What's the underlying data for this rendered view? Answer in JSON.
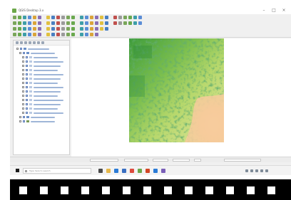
{
  "window": {
    "title": "QGIS Desktop 3.x",
    "controls": {
      "minimize": "–",
      "maximize": "□",
      "close": "×"
    }
  },
  "colors": {
    "accent": "#6ca84a",
    "raster_low": "#f6c99b",
    "raster_mid": "#c8df7a",
    "raster_high": "#1f8a3a"
  },
  "toolbars": {
    "row1_icons": [
      "new-project-icon",
      "open-project-icon",
      "save-project-icon",
      "save-as-icon",
      "print-layout-icon",
      "layout-manager-icon",
      "pan-icon",
      "pan-to-selection-icon",
      "zoom-in-icon",
      "zoom-out-icon",
      "zoom-full-icon",
      "zoom-layer-icon",
      "zoom-native-icon",
      "refresh-icon",
      "identify-icon",
      "select-icon",
      "deselect-icon",
      "measure-icon",
      "attribute-table-icon",
      "field-calculator-icon",
      "statistics-icon",
      "bookmark-icon",
      "tips-icon",
      "plugins-icon"
    ],
    "row2_icons": [
      "add-vector-icon",
      "add-raster-icon",
      "add-mesh-icon",
      "add-csv-icon",
      "add-geopackage-icon",
      "add-spatialite-icon",
      "add-postgis-icon",
      "add-wms-icon",
      "add-wfs-icon",
      "new-shapefile-icon",
      "new-geopackage-icon",
      "digitize-icon",
      "edit-toggle-icon",
      "add-feature-icon",
      "vertex-tool-icon",
      "delete-icon",
      "cut-icon",
      "copy-icon",
      "paste-icon",
      "undo-icon",
      "redo-icon",
      "label-icon",
      "label-pin-icon",
      "diagram-icon"
    ],
    "row3_icons": [
      "processing-icon",
      "python-console-icon",
      "gps-icon",
      "georeferencer-icon",
      "raster-calculator-icon",
      "style-manager-icon",
      "annotation-icon",
      "text-annotation-icon",
      "html-annotation-icon",
      "svg-annotation-icon",
      "form-annotation-icon",
      "measure-angle-icon",
      "measure-area-icon",
      "map-tips-icon",
      "new-bookmark-icon",
      "show-bookmarks-icon",
      "temporal-icon",
      "3d-view-icon"
    ],
    "row4_icons": [
      "snapping-icon",
      "tracing-icon",
      "digitize-settings-icon",
      "avoid-overlap-icon",
      "topology-icon",
      "shape-circle-icon",
      "shape-rect-icon",
      "shape-polygon-icon",
      "offset-curve-icon",
      "reshape-icon",
      "split-icon",
      "merge-icon",
      "rotate-icon",
      "simplify-icon",
      "fill-ring-icon",
      "delete-ring-icon"
    ]
  },
  "layers_panel": {
    "toolbar_icons": [
      "open-layer-styling-icon",
      "add-group-icon",
      "manage-map-themes-icon",
      "filter-legend-icon",
      "expand-all-icon",
      "collapse-all-icon",
      "remove-layer-icon"
    ],
    "rows": [
      {
        "indent": 1,
        "type": "group"
      },
      {
        "indent": 2,
        "type": "raster"
      },
      {
        "indent": 3,
        "type": "band"
      },
      {
        "indent": 3,
        "type": "band"
      },
      {
        "indent": 3,
        "type": "band"
      },
      {
        "indent": 3,
        "type": "band"
      },
      {
        "indent": 3,
        "type": "band"
      },
      {
        "indent": 3,
        "type": "band"
      },
      {
        "indent": 3,
        "type": "band"
      },
      {
        "indent": 3,
        "type": "band"
      },
      {
        "indent": 3,
        "type": "band"
      },
      {
        "indent": 3,
        "type": "band"
      },
      {
        "indent": 3,
        "type": "band"
      },
      {
        "indent": 3,
        "type": "band"
      },
      {
        "indent": 3,
        "type": "band"
      },
      {
        "indent": 3,
        "type": "band"
      },
      {
        "indent": 2,
        "type": "raster"
      },
      {
        "indent": 2,
        "type": "vector"
      }
    ]
  },
  "status_bar": {
    "fields": [
      "coordinate-field",
      "scale-field",
      "magnifier-field",
      "rotation-field",
      "render-toggle",
      "crs-field"
    ]
  },
  "taskbar": {
    "search_placeholder": "Type here to search",
    "pinned_icons": [
      "task-view-icon",
      "file-explorer-icon",
      "edge-icon",
      "store-icon",
      "chrome-icon",
      "qgis-icon",
      "office-icon",
      "mail-icon",
      "photos-icon"
    ],
    "tray_icons": [
      "network-icon",
      "volume-icon",
      "battery-icon",
      "language-icon",
      "notification-icon"
    ]
  }
}
